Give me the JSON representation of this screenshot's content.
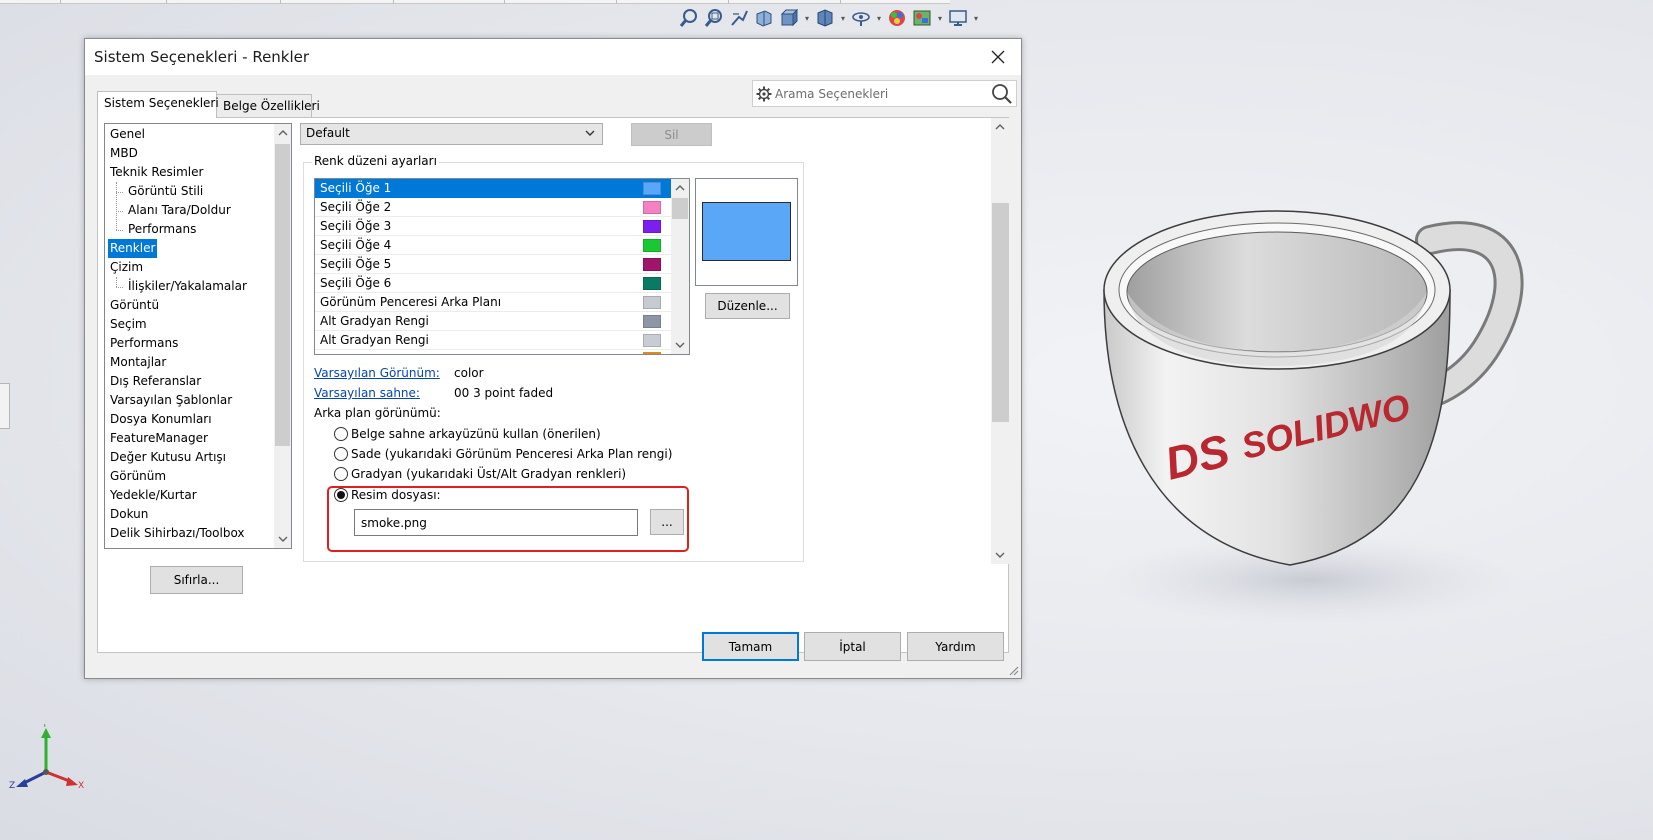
{
  "dialog": {
    "title": "Sistem Seçenekleri - Renkler",
    "search_placeholder": "Arama Seçenekleri",
    "tabs": [
      "Sistem Seçenekleri",
      "Belge Özellikleri"
    ],
    "nav_items": [
      {
        "label": "Genel",
        "level": 0
      },
      {
        "label": "MBD",
        "level": 0
      },
      {
        "label": "Teknik Resimler",
        "level": 0
      },
      {
        "label": "Görüntü Stili",
        "level": 1
      },
      {
        "label": "Alanı Tara/Doldur",
        "level": 1
      },
      {
        "label": "Performans",
        "level": 1
      },
      {
        "label": "Renkler",
        "level": 0,
        "selected": true
      },
      {
        "label": "Çizim",
        "level": 0
      },
      {
        "label": "İlişkiler/Yakalamalar",
        "level": 1
      },
      {
        "label": "Görüntü",
        "level": 0
      },
      {
        "label": "Seçim",
        "level": 0
      },
      {
        "label": "Performans",
        "level": 0
      },
      {
        "label": "Montajlar",
        "level": 0
      },
      {
        "label": "Dış Referanslar",
        "level": 0
      },
      {
        "label": "Varsayılan Şablonlar",
        "level": 0
      },
      {
        "label": "Dosya Konumları",
        "level": 0
      },
      {
        "label": "FeatureManager",
        "level": 0
      },
      {
        "label": "Değer Kutusu Artışı",
        "level": 0
      },
      {
        "label": "Görünüm",
        "level": 0
      },
      {
        "label": "Yedekle/Kurtar",
        "level": 0
      },
      {
        "label": "Dokun",
        "level": 0
      },
      {
        "label": "Delik Sihirbazı/Toolbox",
        "level": 0
      }
    ],
    "reset_label": "Sıfırla...",
    "scheme_value": "Default",
    "delete_label": "Sil",
    "group_label": "Renk düzeni ayarları",
    "color_items": [
      {
        "label": "Seçili Öğe 1",
        "color": "#5aa7f7",
        "selected": true
      },
      {
        "label": "Seçili Öğe 2",
        "color": "#f482c2"
      },
      {
        "label": "Seçili Öğe 3",
        "color": "#7b1ff0"
      },
      {
        "label": "Seçili Öğe 4",
        "color": "#19c832"
      },
      {
        "label": "Seçili Öğe 5",
        "color": "#a0146b"
      },
      {
        "label": "Seçili Öğe 6",
        "color": "#0a7a64"
      },
      {
        "label": "Görünüm Penceresi Arka Planı",
        "color": "#c6cad1"
      },
      {
        "label": "Alt Gradyan Rengi",
        "color": "#8e96a6"
      },
      {
        "label": "Alt Gradyan Rengi",
        "color": "#c8ccd4"
      }
    ],
    "preview_color": "#5aa7f7",
    "edit_label": "Düzenle...",
    "default_appearance_label": "Varsayılan Görünüm:",
    "default_appearance_value": "color",
    "default_scene_label": "Varsayılan sahne:",
    "default_scene_value": "00 3 point faded",
    "background_label": "Arka plan görünümü:",
    "radio_options": [
      "Belge sahne arkayüzünü kullan (önerilen)",
      "Sade (yukarıdaki Görünüm Penceresi Arka Plan rengi)",
      "Gradyan (yukarıdaki Üst/Alt Gradyan renkleri)",
      "Resim dosyası:"
    ],
    "selected_radio": 3,
    "image_file": "smoke.png",
    "browse_label": "...",
    "ok_label": "Tamam",
    "cancel_label": "İptal",
    "help_label": "Yardım"
  },
  "model": {
    "logo_text": "SOLIDWO"
  },
  "axes": {
    "x": "X",
    "y": "Y",
    "z": "Z"
  },
  "colors": {
    "accent": "#0078d7",
    "highlight": "#e02020",
    "logo": "#b8282e"
  }
}
